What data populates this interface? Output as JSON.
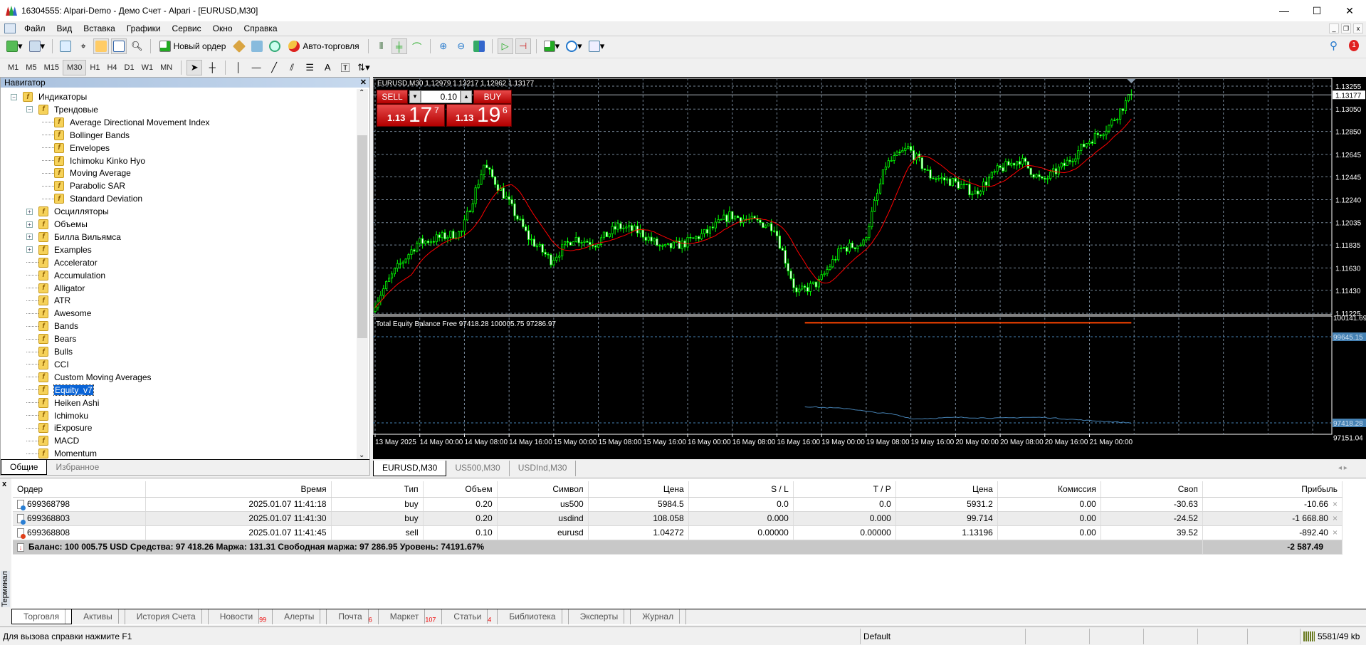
{
  "window": {
    "title": "16304555: Alpari-Demo - Демо Счет - Alpari - [EURUSD,M30]",
    "min": "—",
    "max": "☐",
    "close": "✕"
  },
  "menu": {
    "items": [
      "Файл",
      "Вид",
      "Вставка",
      "Графики",
      "Сервис",
      "Окно",
      "Справка"
    ]
  },
  "toolbar": {
    "new_order": "Новый ордер",
    "auto_trading": "Авто-торговля",
    "notification_count": "1"
  },
  "timeframes": {
    "items": [
      "M1",
      "M5",
      "M15",
      "M30",
      "H1",
      "H4",
      "D1",
      "W1",
      "MN"
    ],
    "selected": "M30"
  },
  "navigator": {
    "title": "Навигатор",
    "items": [
      {
        "label": "Индикаторы",
        "level": 0,
        "exp": "−",
        "icon": "function-folder-icon"
      },
      {
        "label": "Трендовые",
        "level": 1,
        "exp": "−",
        "icon": "function-folder-icon"
      },
      {
        "label": "Average Directional Movement Index",
        "level": 2,
        "icon": "indicator-icon"
      },
      {
        "label": "Bollinger Bands",
        "level": 2,
        "icon": "indicator-icon"
      },
      {
        "label": "Envelopes",
        "level": 2,
        "icon": "indicator-icon"
      },
      {
        "label": "Ichimoku Kinko Hyo",
        "level": 2,
        "icon": "indicator-icon"
      },
      {
        "label": "Moving Average",
        "level": 2,
        "icon": "indicator-icon"
      },
      {
        "label": "Parabolic SAR",
        "level": 2,
        "icon": "indicator-icon"
      },
      {
        "label": "Standard Deviation",
        "level": 2,
        "icon": "indicator-icon"
      },
      {
        "label": "Осцилляторы",
        "level": 1,
        "exp": "+",
        "icon": "function-folder-icon"
      },
      {
        "label": "Объемы",
        "level": 1,
        "exp": "+",
        "icon": "function-folder-icon"
      },
      {
        "label": "Билла Вильямса",
        "level": 1,
        "exp": "+",
        "icon": "function-folder-icon"
      },
      {
        "label": "Examples",
        "level": 1,
        "exp": "+",
        "icon": "custom-indicator-icon"
      },
      {
        "label": "Accelerator",
        "level": 1,
        "icon": "custom-indicator-icon"
      },
      {
        "label": "Accumulation",
        "level": 1,
        "icon": "custom-indicator-icon"
      },
      {
        "label": "Alligator",
        "level": 1,
        "icon": "custom-indicator-icon"
      },
      {
        "label": "ATR",
        "level": 1,
        "icon": "custom-indicator-icon"
      },
      {
        "label": "Awesome",
        "level": 1,
        "icon": "custom-indicator-icon"
      },
      {
        "label": "Bands",
        "level": 1,
        "icon": "custom-indicator-icon"
      },
      {
        "label": "Bears",
        "level": 1,
        "icon": "custom-indicator-icon"
      },
      {
        "label": "Bulls",
        "level": 1,
        "icon": "custom-indicator-icon"
      },
      {
        "label": "CCI",
        "level": 1,
        "icon": "custom-indicator-icon"
      },
      {
        "label": "Custom Moving Averages",
        "level": 1,
        "icon": "custom-indicator-icon"
      },
      {
        "label": "Equity_v7",
        "level": 1,
        "icon": "custom-indicator-icon",
        "selected": true
      },
      {
        "label": "Heiken Ashi",
        "level": 1,
        "icon": "custom-indicator-icon"
      },
      {
        "label": "Ichimoku",
        "level": 1,
        "icon": "custom-indicator-icon"
      },
      {
        "label": "iExposure",
        "level": 1,
        "icon": "custom-indicator-icon"
      },
      {
        "label": "MACD",
        "level": 1,
        "icon": "custom-indicator-icon"
      },
      {
        "label": "Momentum",
        "level": 1,
        "icon": "custom-indicator-icon"
      }
    ],
    "tabs": [
      "Общие",
      "Избранное"
    ]
  },
  "chart": {
    "header": "EURUSD,M30  1.12979 1.13217 1.12962 1.13177",
    "sell_label": "SELL",
    "buy_label": "BUY",
    "lot": "0.10",
    "sell_big": "1.13",
    "sell_pips": "17",
    "sell_frac": "7",
    "buy_big": "1.13",
    "buy_pips": "19",
    "buy_frac": "6",
    "sub_header": "Total Equity Balance Free 97418.28 100005.75 97286.97",
    "tabs": [
      "EURUSD,M30",
      "US500,M30",
      "USDInd,M30"
    ],
    "active_tab": "EURUSD,M30",
    "colors": {
      "bull": "#00ff00",
      "ma": "#ff0000",
      "balance": "#ff4500",
      "equity": "#4682b4",
      "grid": "#778899"
    }
  },
  "chart_data": [
    {
      "type": "candlestick",
      "symbol": "EURUSD,M30",
      "time_labels": [
        "13 May 2025",
        "14 May 00:00",
        "14 May 08:00",
        "14 May 16:00",
        "15 May 00:00",
        "15 May 08:00",
        "15 May 16:00",
        "16 May 00:00",
        "16 May 08:00",
        "16 May 16:00",
        "19 May 00:00",
        "19 May 08:00",
        "19 May 16:00",
        "20 May 00:00",
        "20 May 08:00",
        "20 May 16:00",
        "21 May 00:00"
      ],
      "price_ticks": [
        "1.13255",
        "1.13050",
        "1.12850",
        "1.12645",
        "1.12445",
        "1.12240",
        "1.12035",
        "1.11835",
        "1.11630",
        "1.11430",
        "1.11225"
      ],
      "ylim": [
        1.11225,
        1.13255
      ],
      "current_price": "1.13177",
      "close_every_4h": [
        1.1128,
        1.116,
        1.1185,
        1.119,
        1.1195,
        1.1255,
        1.1225,
        1.119,
        1.117,
        1.119,
        1.1185,
        1.12,
        1.1195,
        1.118,
        1.1185,
        1.1195,
        1.121,
        1.1205,
        1.12,
        1.114,
        1.115,
        1.118,
        1.1185,
        1.1255,
        1.127,
        1.1245,
        1.124,
        1.123,
        1.125,
        1.126,
        1.124,
        1.1255,
        1.1275,
        1.129,
        1.13177
      ],
      "grid": true
    },
    {
      "type": "line",
      "name": "Total Equity Balance Free",
      "value_labels": [
        "100141.69",
        "99645.15",
        "97418.28",
        "97151.04"
      ],
      "ylim": [
        97151.04,
        100141.69
      ],
      "balance": 100005.75,
      "equity_every_4h_from_16_May_20_00": [
        97840,
        97810,
        97790,
        97700,
        97650,
        97520,
        97540,
        97560,
        97550,
        97540,
        97560,
        97560,
        97520,
        97480,
        97450,
        97418.28
      ],
      "levels": [
        99645.15,
        97418.28
      ]
    }
  ],
  "terminal": {
    "side_label": "Терминал",
    "columns": [
      "Ордер",
      "Время",
      "Тип",
      "Объем",
      "Символ",
      "Цена",
      "S / L",
      "T / P",
      "Цена",
      "Комиссия",
      "Своп",
      "Прибыль"
    ],
    "rows": [
      {
        "order": "699368798",
        "time": "2025.01.07 11:41:18",
        "type": "buy",
        "volume": "0.20",
        "symbol": "us500",
        "price": "5984.5",
        "sl": "0.0",
        "tp": "0.0",
        "cur": "5931.2",
        "commission": "0.00",
        "swap": "-30.63",
        "profit": "-10.66"
      },
      {
        "order": "699368803",
        "time": "2025.01.07 11:41:30",
        "type": "buy",
        "volume": "0.20",
        "symbol": "usdind",
        "price": "108.058",
        "sl": "0.000",
        "tp": "0.000",
        "cur": "99.714",
        "commission": "0.00",
        "swap": "-24.52",
        "profit": "-1 668.80"
      },
      {
        "order": "699368808",
        "time": "2025.01.07 11:41:45",
        "type": "sell",
        "volume": "0.10",
        "symbol": "eurusd",
        "price": "1.04272",
        "sl": "0.00000",
        "tp": "0.00000",
        "cur": "1.13196",
        "commission": "0.00",
        "swap": "39.52",
        "profit": "-892.40"
      }
    ],
    "summary": "Баланс: 100 005.75 USD  Средства: 97 418.26  Маржа: 131.31  Свободная маржа: 97 286.95  Уровень: 74191.67%",
    "total_profit": "-2 587.49",
    "tabs": [
      {
        "label": "Торговля",
        "active": true
      },
      {
        "label": "Активы"
      },
      {
        "label": "История Счета"
      },
      {
        "label": "Новости",
        "count": "99"
      },
      {
        "label": "Алерты"
      },
      {
        "label": "Почта",
        "count": "6"
      },
      {
        "label": "Маркет",
        "count": "107"
      },
      {
        "label": "Статьи",
        "count": "4"
      },
      {
        "label": "Библиотека"
      },
      {
        "label": "Эксперты"
      },
      {
        "label": "Журнал"
      }
    ]
  },
  "status": {
    "help": "Для вызова справки нажмите F1",
    "profile": "Default",
    "traffic": "5581/49 kb"
  }
}
